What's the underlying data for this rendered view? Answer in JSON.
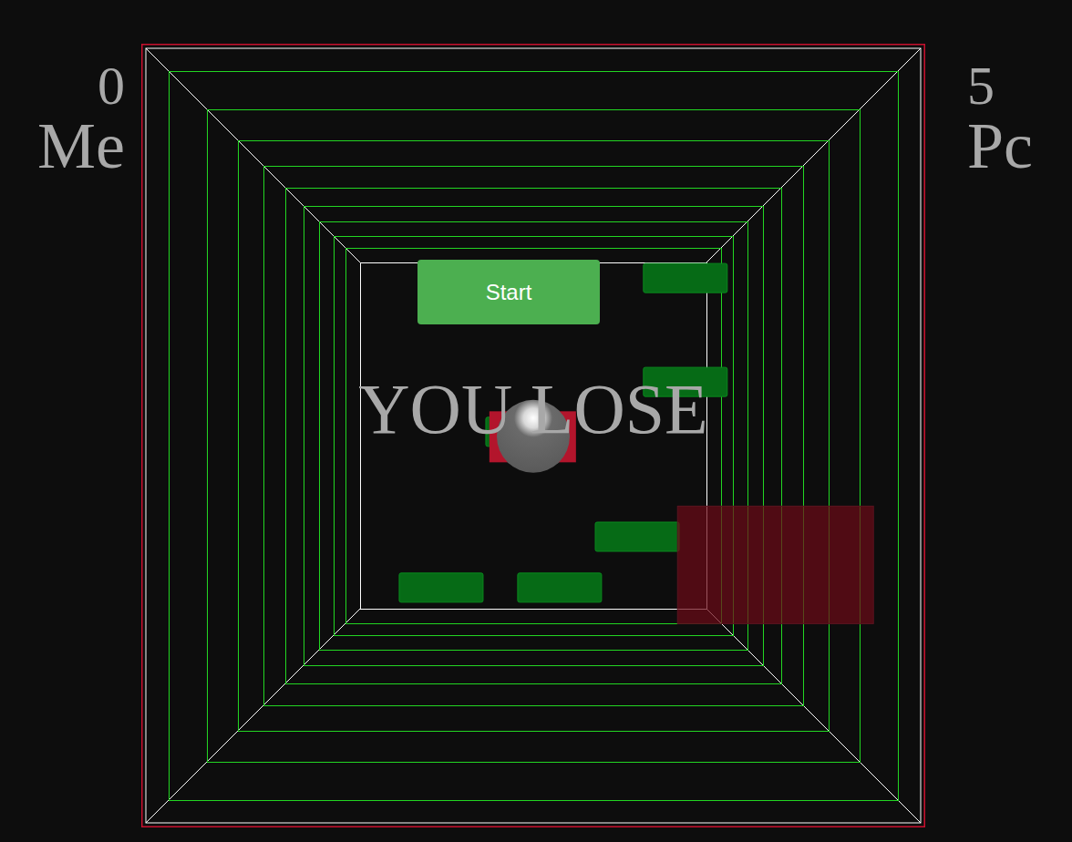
{
  "scores": {
    "player": {
      "label": "Me",
      "value": "0"
    },
    "computer": {
      "label": "Pc",
      "value": "5"
    }
  },
  "start_button": {
    "label": "Start"
  },
  "message": "YOU LOSE",
  "bricks": [
    {
      "x": 0.818,
      "y": 0.003
    },
    {
      "x": 0.818,
      "y": 0.303
    },
    {
      "x": 0.363,
      "y": 0.447
    },
    {
      "x": 0.679,
      "y": 0.75
    },
    {
      "x": 0.113,
      "y": 0.897
    },
    {
      "x": 0.455,
      "y": 0.897
    }
  ],
  "ball": {
    "x": 0.5,
    "y": 0.501
  },
  "pc_paddle": {
    "x": 0.444,
    "y": 0.469
  },
  "player_paddle": {
    "x": 0.684,
    "y": 0.59
  }
}
